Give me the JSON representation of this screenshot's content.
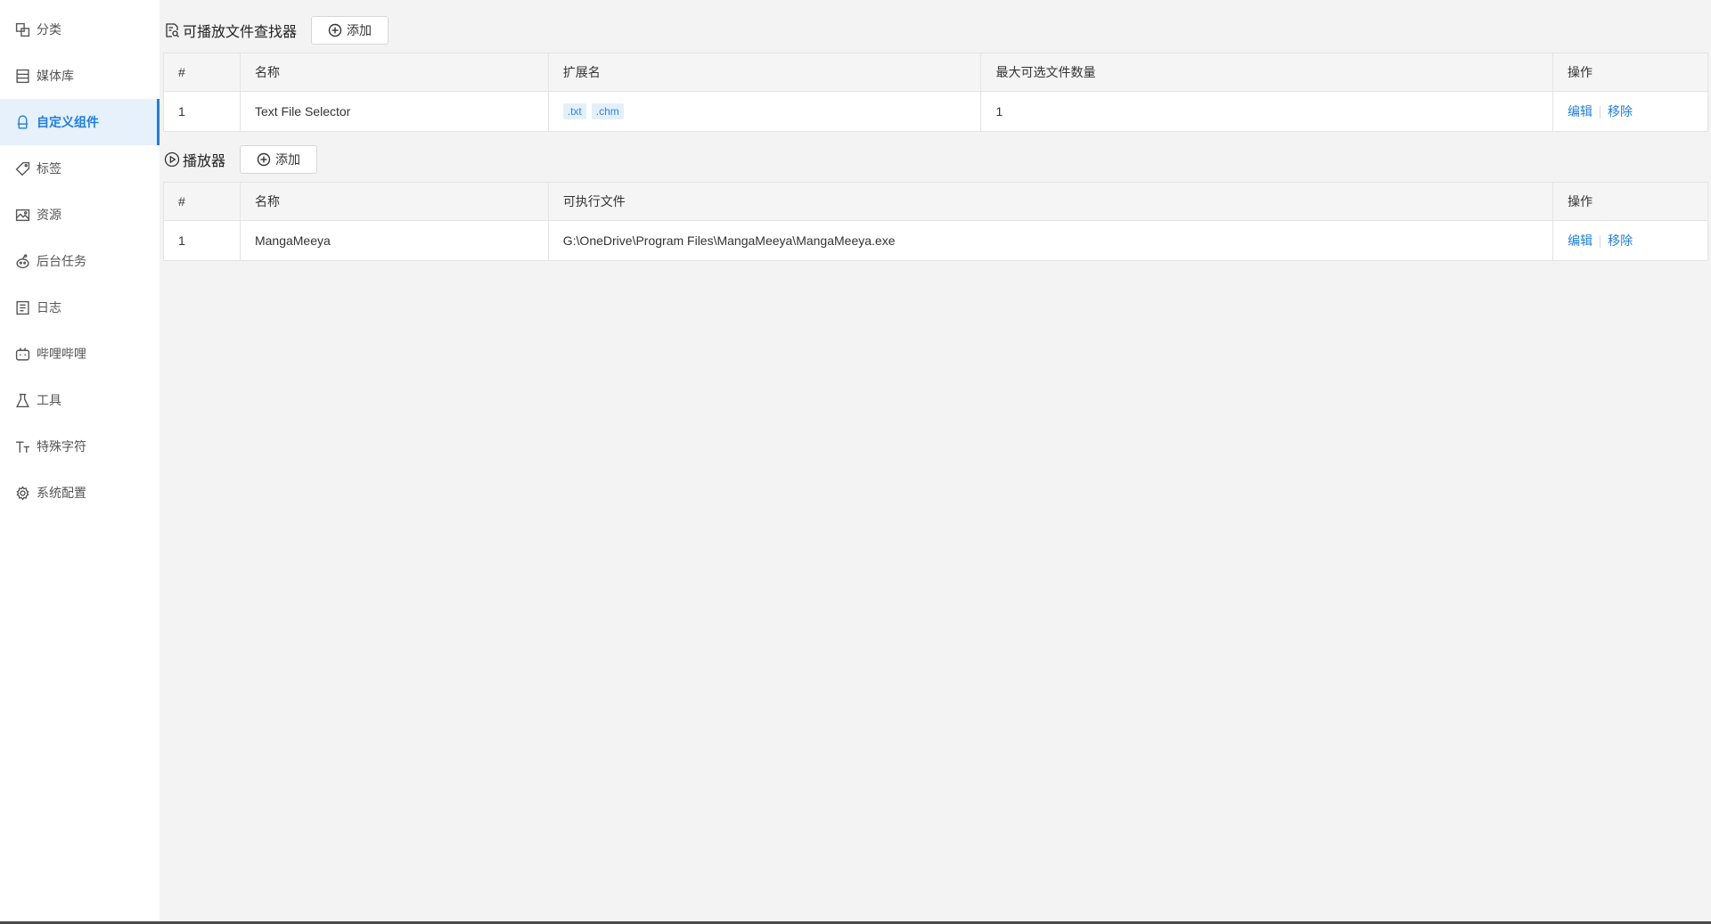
{
  "sidebar": {
    "items": [
      {
        "label": "分类",
        "icon": "category-icon"
      },
      {
        "label": "媒体库",
        "icon": "media-library-icon"
      },
      {
        "label": "自定义组件",
        "icon": "custom-component-icon",
        "active": true
      },
      {
        "label": "标签",
        "icon": "tag-icon"
      },
      {
        "label": "资源",
        "icon": "image-icon"
      },
      {
        "label": "后台任务",
        "icon": "background-task-icon"
      },
      {
        "label": "日志",
        "icon": "log-icon"
      },
      {
        "label": "哔哩哔哩",
        "icon": "bilibili-icon"
      },
      {
        "label": "工具",
        "icon": "flask-icon"
      },
      {
        "label": "特殊字符",
        "icon": "text-size-icon"
      },
      {
        "label": "系统配置",
        "icon": "gear-icon"
      }
    ]
  },
  "finder": {
    "title": "可播放文件查找器",
    "add_label": "添加",
    "columns": [
      "#",
      "名称",
      "扩展名",
      "最大可选文件数量",
      "操作"
    ],
    "rows": [
      {
        "index": "1",
        "name": "Text File Selector",
        "extensions": [
          ".txt",
          ".chm"
        ],
        "max_files": "1",
        "edit": "编辑",
        "remove": "移除"
      }
    ]
  },
  "player": {
    "title": "播放器",
    "add_label": "添加",
    "columns": [
      "#",
      "名称",
      "可执行文件",
      "操作"
    ],
    "rows": [
      {
        "index": "1",
        "name": "MangaMeeya",
        "executable": "G:\\OneDrive\\Program Files\\MangaMeeya\\MangaMeeya.exe",
        "edit": "编辑",
        "remove": "移除"
      }
    ]
  },
  "colors": {
    "accent": "#1e7fe0",
    "active_bg": "#e6f1fb",
    "tag_bg": "#e3f0fc"
  }
}
